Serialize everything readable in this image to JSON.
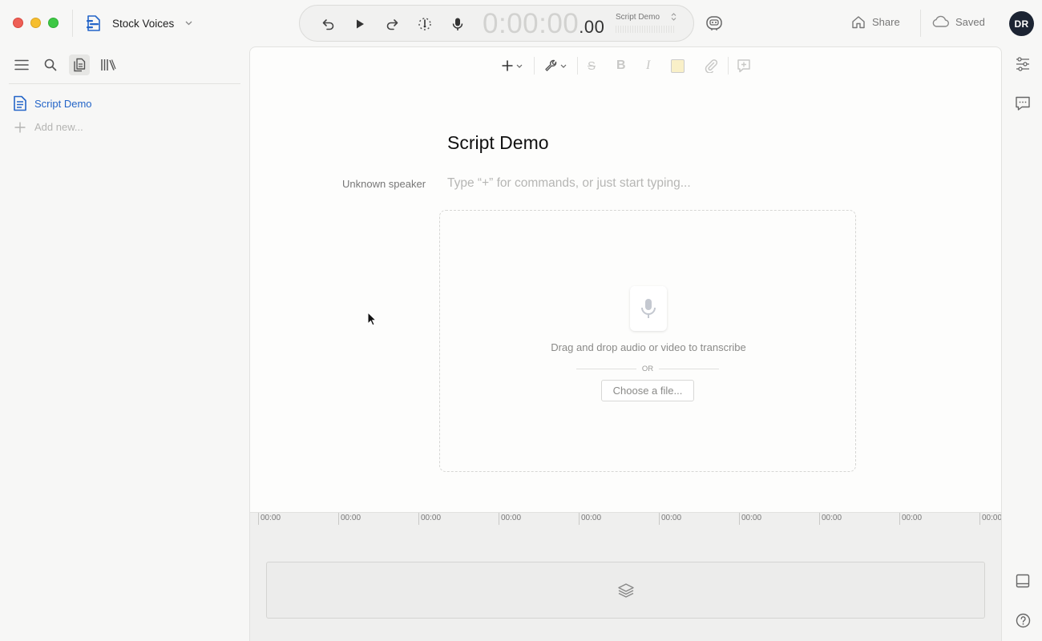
{
  "window": {
    "project_name": "Stock Voices",
    "colors": {
      "accent": "#2465c8",
      "avatar_bg": "#1c2433"
    }
  },
  "transport": {
    "timecode_main": "0:00:00",
    "timecode_frac": ".00",
    "project_selector": "Script Demo",
    "icons": [
      "undo-icon",
      "play-icon",
      "redo-icon",
      "loop-icon",
      "microphone-icon"
    ]
  },
  "header": {
    "share_label": "Share",
    "saved_label": "Saved",
    "avatar_initials": "DR"
  },
  "sidebar": {
    "tools": [
      "menu-icon",
      "search-icon",
      "documents-icon",
      "library-icon"
    ],
    "documents": [
      {
        "label": "Script Demo",
        "icon": "document-icon",
        "active": true
      }
    ],
    "add_new_label": "Add new..."
  },
  "editor": {
    "toolbar_icons": [
      "add-icon",
      "wrench-icon",
      "strikethrough-icon",
      "bold-icon",
      "italic-icon",
      "highlight-color-icon",
      "attachment-icon",
      "add-comment-icon"
    ],
    "bold_glyph": "B",
    "italic_glyph": "I",
    "strike_glyph": "S",
    "title": "Script Demo",
    "speaker_label": "Unknown speaker",
    "placeholder": "Type “+” for commands, or just start typing...",
    "dropzone": {
      "instruction": "Drag and drop audio or video to transcribe",
      "or_label": "OR",
      "choose_button": "Choose a file..."
    }
  },
  "timeline": {
    "ticks": [
      "00:00",
      "00:00",
      "00:00",
      "00:00",
      "00:00",
      "00:00",
      "00:00",
      "00:00",
      "00:00",
      "00:00"
    ]
  },
  "rail": {
    "icons": [
      "properties-icon",
      "comments-icon",
      "panel-toggle-icon",
      "help-icon"
    ]
  }
}
